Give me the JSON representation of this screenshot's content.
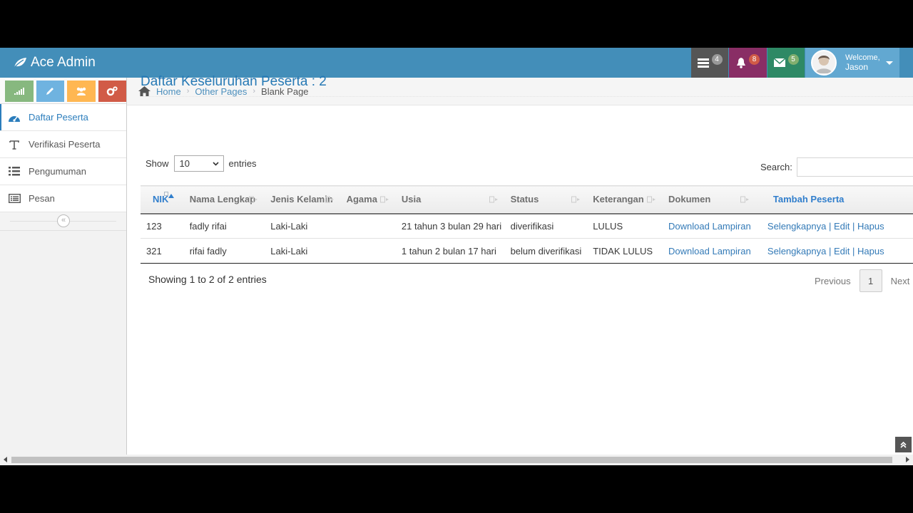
{
  "brand": {
    "title": "Ace Admin"
  },
  "navbar": {
    "tasks_badge": "4",
    "notifications_badge": "8",
    "messages_badge": "5",
    "welcome": "Welcome,",
    "user_name": "Jason",
    "colors": {
      "tasks_badge": "#999999",
      "notifications_badge": "#d15b47",
      "messages_badge": "#82af6f"
    }
  },
  "shortcuts": [
    {
      "icon": "signal-icon",
      "color": "#87b87f"
    },
    {
      "icon": "pencil-icon",
      "color": "#6fb3e0"
    },
    {
      "icon": "users-icon",
      "color": "#ffb752"
    },
    {
      "icon": "cogs-icon",
      "color": "#d15b47"
    }
  ],
  "sidebar": {
    "items": [
      {
        "label": "Daftar Peserta",
        "icon": "dashboard-icon",
        "active": true
      },
      {
        "label": "Verifikasi Peserta",
        "icon": "text-icon",
        "active": false
      },
      {
        "label": "Pengumuman",
        "icon": "list-icon",
        "active": false
      },
      {
        "label": "Pesan",
        "icon": "list-alt-icon",
        "active": false
      }
    ],
    "collapse": "«"
  },
  "breadcrumb": {
    "home": "Home",
    "parent": "Other Pages",
    "current": "Blank Page"
  },
  "page": {
    "title": "Daftar Keseluruhan Peserta : 2"
  },
  "table_controls": {
    "show_label": "Show",
    "length_value": "10",
    "entries_label": "entries",
    "search_label": "Search:",
    "search_value": ""
  },
  "table": {
    "headers": [
      "NIK",
      "Nama Lengkap",
      "Jenis Kelamin",
      "Agama",
      "Usia",
      "Status",
      "Keterangan",
      "Dokumen",
      "Tambah Peserta"
    ],
    "rows": [
      {
        "nik": "123",
        "nama": "fadly rifai",
        "jk": "Laki-Laki",
        "agama": "",
        "usia": "21 tahun 3 bulan 29 hari",
        "status": "diverifikasi",
        "keterangan": "LULUS",
        "dokumen": "Download Lampiran",
        "more": "Selengkapnya",
        "edit": "Edit",
        "hapus": "Hapus"
      },
      {
        "nik": "321",
        "nama": "rifai fadly",
        "jk": "Laki-Laki",
        "agama": "",
        "usia": "1 tahun 2 bulan 17 hari",
        "status": "belum diverifikasi",
        "keterangan": "TIDAK LULUS",
        "dokumen": "Download Lampiran",
        "more": "Selengkapnya",
        "edit": "Edit",
        "hapus": "Hapus"
      }
    ],
    "sep": "|"
  },
  "footer": {
    "info": "Showing 1 to 2 of 2 entries",
    "previous": "Previous",
    "page": "1",
    "next": "Next"
  }
}
